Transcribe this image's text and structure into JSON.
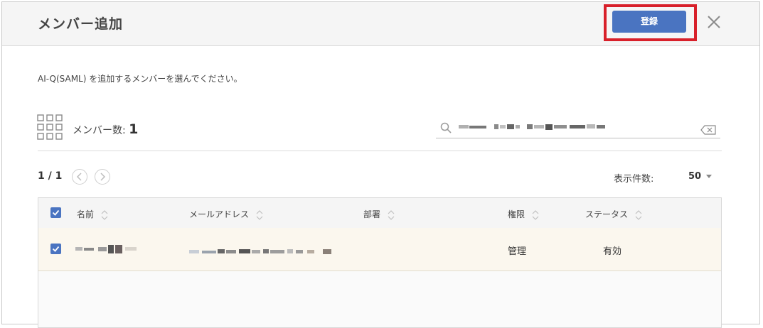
{
  "dialog": {
    "title": "メンバー追加",
    "register_label": "登録",
    "close_icon": "close-icon"
  },
  "description": "AI-Q(SAML) を追加するメンバーを選んでください。",
  "member_count": {
    "label": "メンバー数:",
    "value": "1"
  },
  "search": {
    "icon": "search-icon",
    "clear_icon": "clear-icon"
  },
  "pager": {
    "label": "1 / 1",
    "prev_icon": "chevron-left-icon",
    "next_icon": "chevron-right-icon",
    "per_page_label": "表示件数:",
    "per_page_value": "50"
  },
  "table": {
    "columns": [
      "名前",
      "メールアドレス",
      "部署",
      "権限",
      "ステータス"
    ],
    "rows": [
      {
        "selected": true,
        "role": "管理",
        "status": "有効"
      }
    ]
  },
  "colors": {
    "accent": "#4a74c1",
    "highlight": "#d8202a",
    "row_bg": "#fbf7ee"
  }
}
